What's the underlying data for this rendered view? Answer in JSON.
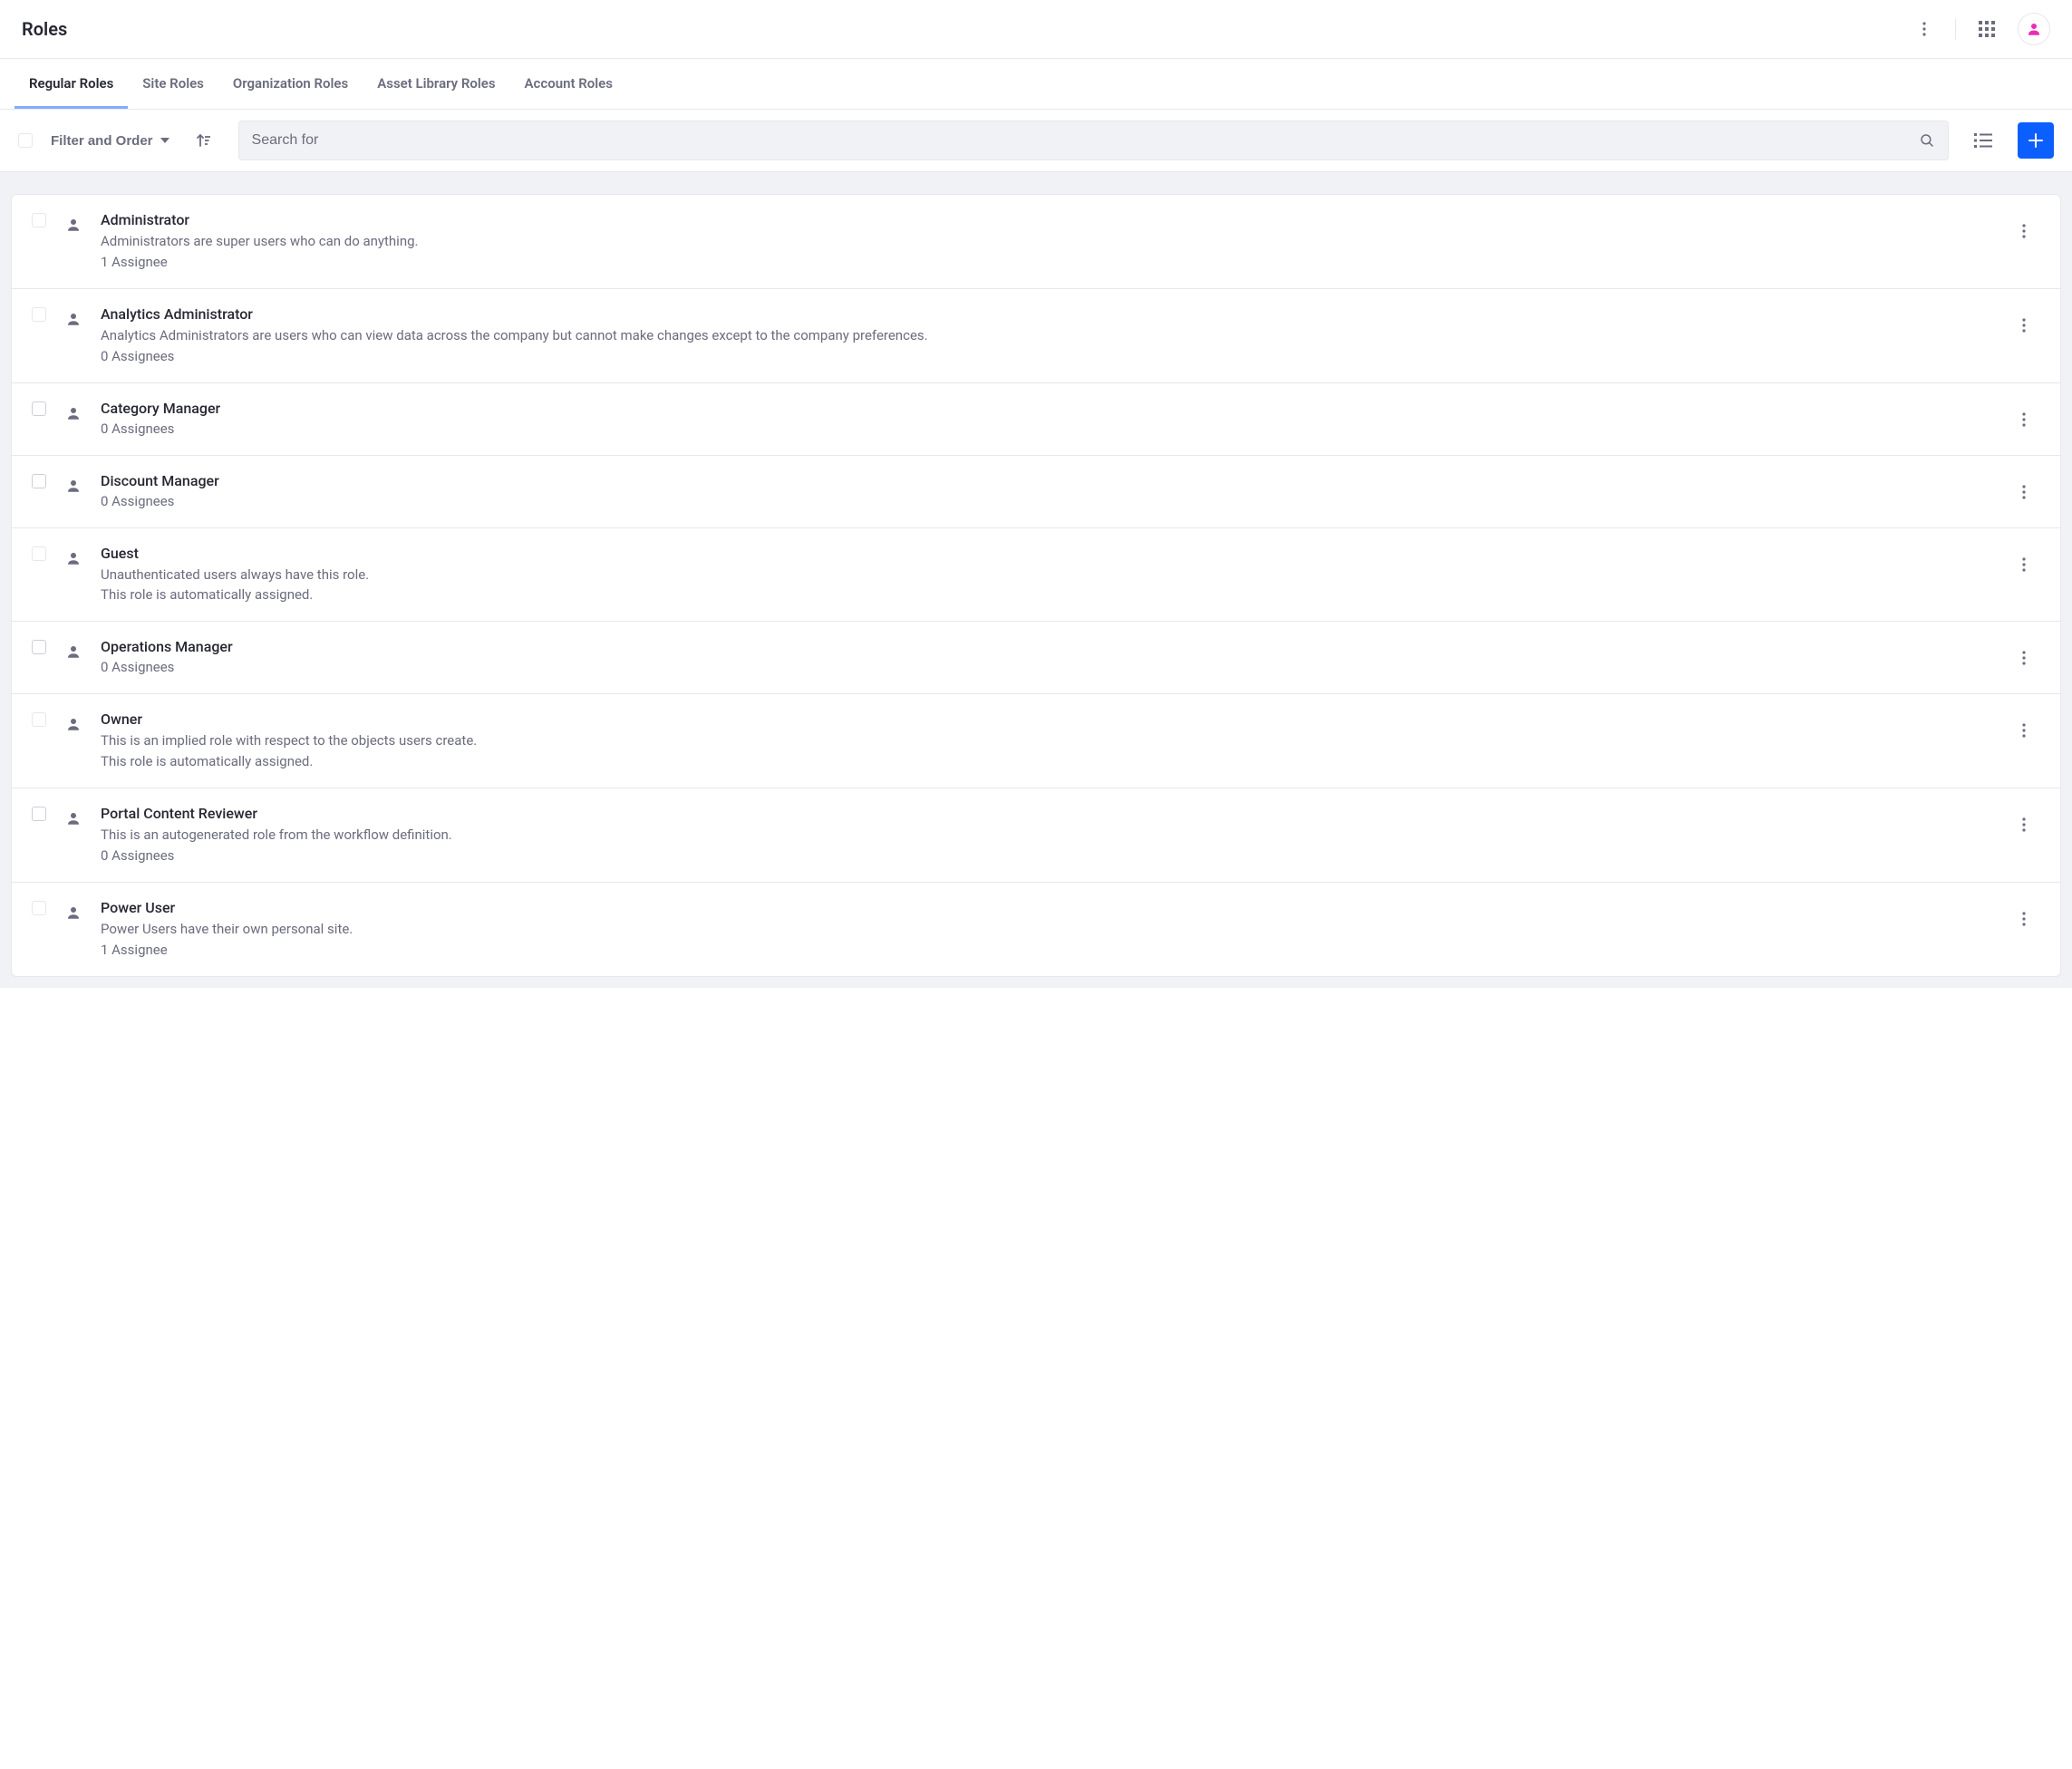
{
  "header": {
    "title": "Roles"
  },
  "tabs": [
    {
      "label": "Regular Roles",
      "active": true
    },
    {
      "label": "Site Roles",
      "active": false
    },
    {
      "label": "Organization Roles",
      "active": false
    },
    {
      "label": "Asset Library Roles",
      "active": false
    },
    {
      "label": "Account Roles",
      "active": false
    }
  ],
  "toolbar": {
    "filter_label": "Filter and Order",
    "search_placeholder": "Search for"
  },
  "roles": [
    {
      "title": "Administrator",
      "description": "Administrators are super users who can do anything.",
      "sub": "1 Assignee",
      "check": "light"
    },
    {
      "title": "Analytics Administrator",
      "description": "Analytics Administrators are users who can view data across the company but cannot make changes except to the company preferences.",
      "sub": "0 Assignees",
      "check": "light"
    },
    {
      "title": "Category Manager",
      "description": "",
      "sub": "0 Assignees",
      "check": "dark"
    },
    {
      "title": "Discount Manager",
      "description": "",
      "sub": "0 Assignees",
      "check": "dark"
    },
    {
      "title": "Guest",
      "description": "Unauthenticated users always have this role.",
      "sub": "This role is automatically assigned.",
      "check": "light"
    },
    {
      "title": "Operations Manager",
      "description": "",
      "sub": "0 Assignees",
      "check": "dark"
    },
    {
      "title": "Owner",
      "description": "This is an implied role with respect to the objects users create.",
      "sub": "This role is automatically assigned.",
      "check": "light"
    },
    {
      "title": "Portal Content Reviewer",
      "description": "This is an autogenerated role from the workflow definition.",
      "sub": "0 Assignees",
      "check": "dark"
    },
    {
      "title": "Power User",
      "description": "Power Users have their own personal site.",
      "sub": "1 Assignee",
      "check": "light"
    }
  ]
}
